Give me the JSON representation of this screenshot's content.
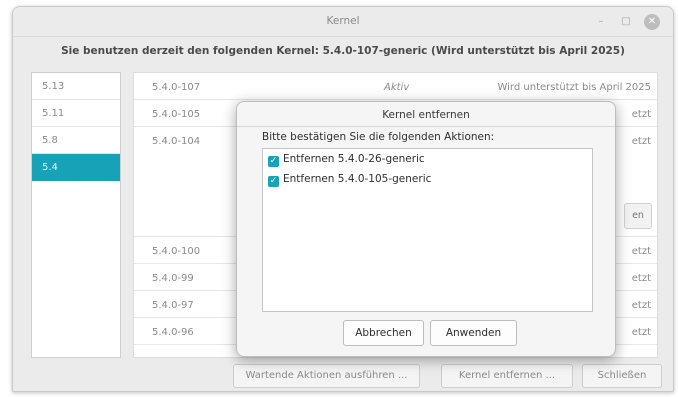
{
  "window": {
    "title": "Kernel"
  },
  "info": "Sie benutzen derzeit den folgenden Kernel: 5.4.0-107-generic (Wird unterstützt bis April 2025)",
  "sidebar": {
    "items": [
      {
        "label": "5.13"
      },
      {
        "label": "5.11"
      },
      {
        "label": "5.8"
      },
      {
        "label": "5.4",
        "selected": true
      }
    ]
  },
  "kernels": [
    {
      "version": "5.4.0-107",
      "status": "Aktiv",
      "support": "Wird unterstützt bis April 2025"
    },
    {
      "version": "5.4.0-105",
      "status": "",
      "support": "etzt"
    },
    {
      "version": "5.4.0-104",
      "status": "",
      "support": "etzt",
      "button_fragment": "en"
    },
    {
      "version": "5.4.0-100",
      "status": "",
      "support": "etzt"
    },
    {
      "version": "5.4.0-99",
      "status": "",
      "support": "etzt"
    },
    {
      "version": "5.4.0-97",
      "status": "",
      "support": "etzt"
    },
    {
      "version": "5.4.0-96",
      "status": "",
      "support": "etzt"
    }
  ],
  "buttons": {
    "pending": "Wartende Aktionen ausführen ...",
    "remove": "Kernel entfernen ...",
    "close": "Schließen"
  },
  "dialog": {
    "title": "Kernel entfernen",
    "prompt": "Bitte bestätigen Sie die folgenden Aktionen:",
    "actions": [
      {
        "label": "Entfernen 5.4.0-26-generic",
        "checked": true
      },
      {
        "label": "Entfernen 5.4.0-105-generic",
        "checked": true
      }
    ],
    "cancel": "Abbrechen",
    "apply": "Anwenden"
  },
  "colors": {
    "accent": "#17a2b8"
  }
}
